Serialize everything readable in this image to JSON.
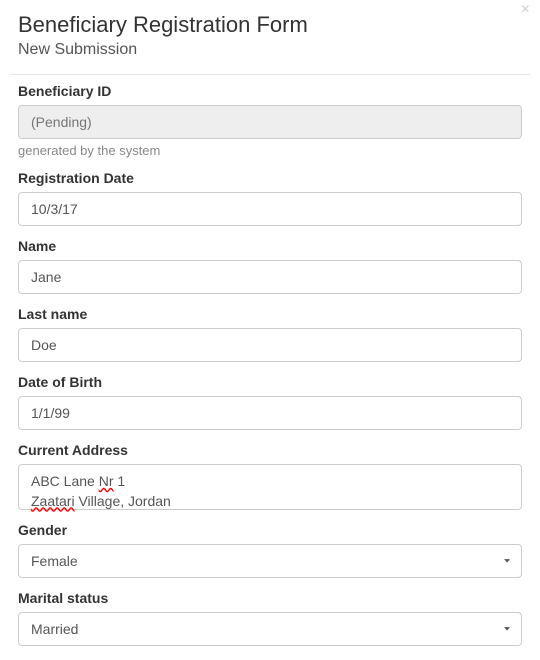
{
  "header": {
    "title": "Beneficiary Registration Form",
    "subtitle": "New Submission"
  },
  "fields": {
    "beneficiary_id": {
      "label": "Beneficiary ID",
      "placeholder": "(Pending)",
      "help": "generated by the system"
    },
    "registration_date": {
      "label": "Registration Date",
      "value": "10/3/17"
    },
    "name": {
      "label": "Name",
      "value": "Jane"
    },
    "last_name": {
      "label": "Last name",
      "value": "Doe"
    },
    "dob": {
      "label": "Date of Birth",
      "value": "1/1/99"
    },
    "address": {
      "label": "Current Address",
      "line1_a": "ABC Lane ",
      "line1_b": "Nr",
      "line1_c": " 1",
      "line2_a": "Zaatari",
      "line2_b": " Village, Jordan"
    },
    "gender": {
      "label": "Gender",
      "value": "Female"
    },
    "marital": {
      "label": "Marital status",
      "value": "Married"
    }
  }
}
